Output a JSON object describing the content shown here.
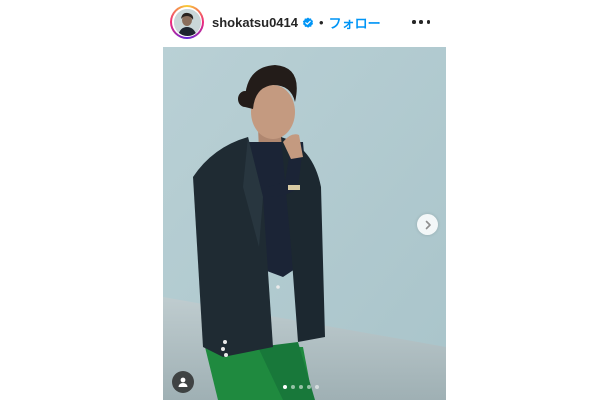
{
  "post_header": {
    "username": "shokatsu0414",
    "separator": "•",
    "follow_label": "フォロー",
    "verified_icon": "verified-badge-icon",
    "more_icon": "more-options-icon"
  },
  "post_media": {
    "image_alt": "photo",
    "next_icon": "chevron-right-icon",
    "tag_icon": "user-tag-icon",
    "carousel_total": 5,
    "carousel_active_index": 0
  },
  "colors": {
    "follow": "#0095f6",
    "verified": "#0095f6",
    "text": "#262626"
  }
}
